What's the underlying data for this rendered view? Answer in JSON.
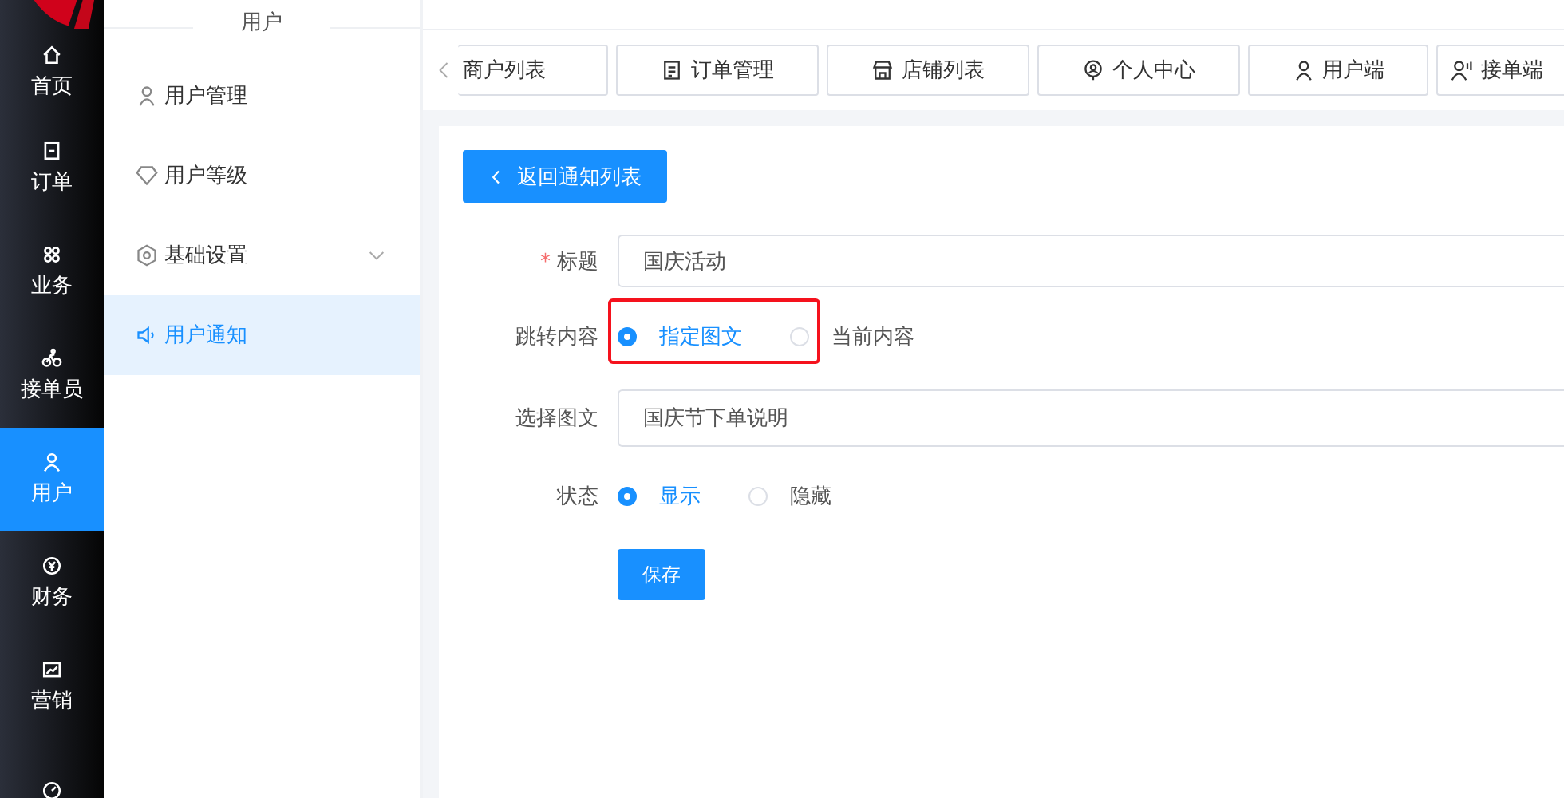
{
  "rail": {
    "items": [
      {
        "label": "首页",
        "selected": false
      },
      {
        "label": "订单",
        "selected": false
      },
      {
        "label": "业务",
        "selected": false
      },
      {
        "label": "接单员",
        "selected": false
      },
      {
        "label": "用户",
        "selected": true
      },
      {
        "label": "财务",
        "selected": false
      },
      {
        "label": "营销",
        "selected": false
      }
    ]
  },
  "submenu": {
    "title": "用户",
    "items": [
      {
        "label": "用户管理",
        "selected": false,
        "expandable": false
      },
      {
        "label": "用户等级",
        "selected": false,
        "expandable": false
      },
      {
        "label": "基础设置",
        "selected": false,
        "expandable": true
      },
      {
        "label": "用户通知",
        "selected": true,
        "expandable": false
      }
    ]
  },
  "tabs": [
    {
      "label": "商户列表"
    },
    {
      "label": "订单管理"
    },
    {
      "label": "店铺列表"
    },
    {
      "label": "个人中心"
    },
    {
      "label": "用户端"
    },
    {
      "label": "接单端"
    }
  ],
  "back_button": "返回通知列表",
  "form": {
    "fields": [
      {
        "kind": "input",
        "label": "标题",
        "required_mark": "*",
        "value": "国庆活动"
      },
      {
        "kind": "radio",
        "label": "跳转内容",
        "highlighted": true,
        "options": [
          {
            "label": "指定图文",
            "selected": true
          },
          {
            "label": "当前内容",
            "selected": false
          }
        ]
      },
      {
        "kind": "input",
        "label": "选择图文",
        "value": "国庆节下单说明"
      },
      {
        "kind": "radio",
        "label": "状态",
        "highlighted": false,
        "options": [
          {
            "label": "显示",
            "selected": true
          },
          {
            "label": "隐藏",
            "selected": false
          }
        ]
      }
    ],
    "submit": "保存"
  }
}
